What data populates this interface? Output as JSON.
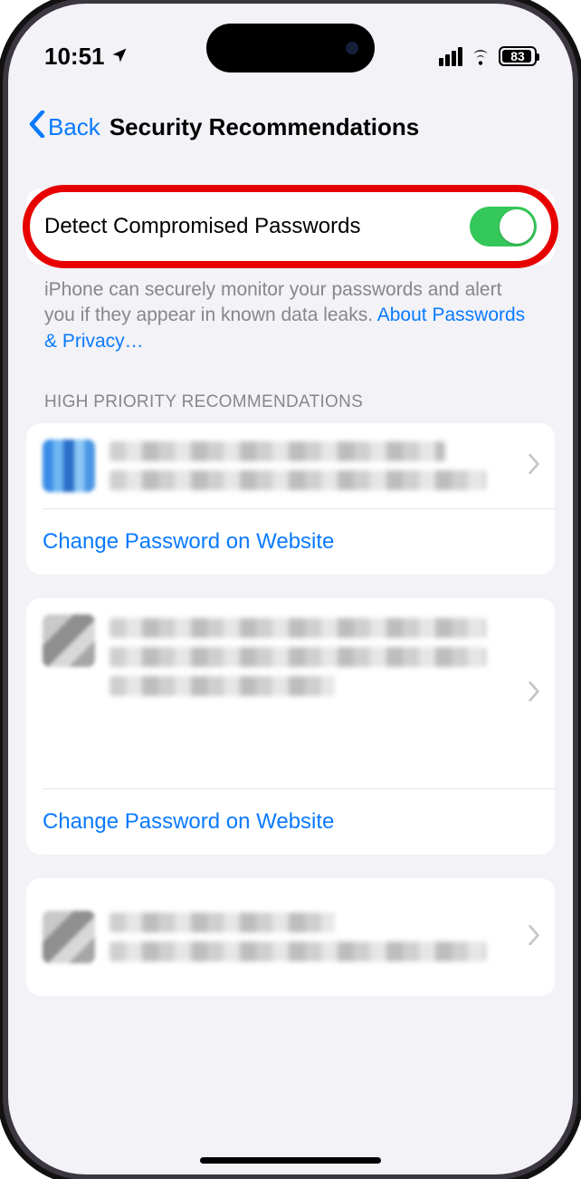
{
  "status": {
    "time": "10:51",
    "battery_pct": "83"
  },
  "nav": {
    "back": "Back",
    "title": "Security Recommendations"
  },
  "toggle": {
    "label": "Detect Compromised Passwords",
    "on": true
  },
  "footer": {
    "text": "iPhone can securely monitor your passwords and alert you if they appear in known data leaks. ",
    "link": "About Passwords & Privacy…"
  },
  "section": {
    "header": "HIGH PRIORITY RECOMMENDATIONS"
  },
  "actions": {
    "change_pw": "Change Password on Website"
  }
}
